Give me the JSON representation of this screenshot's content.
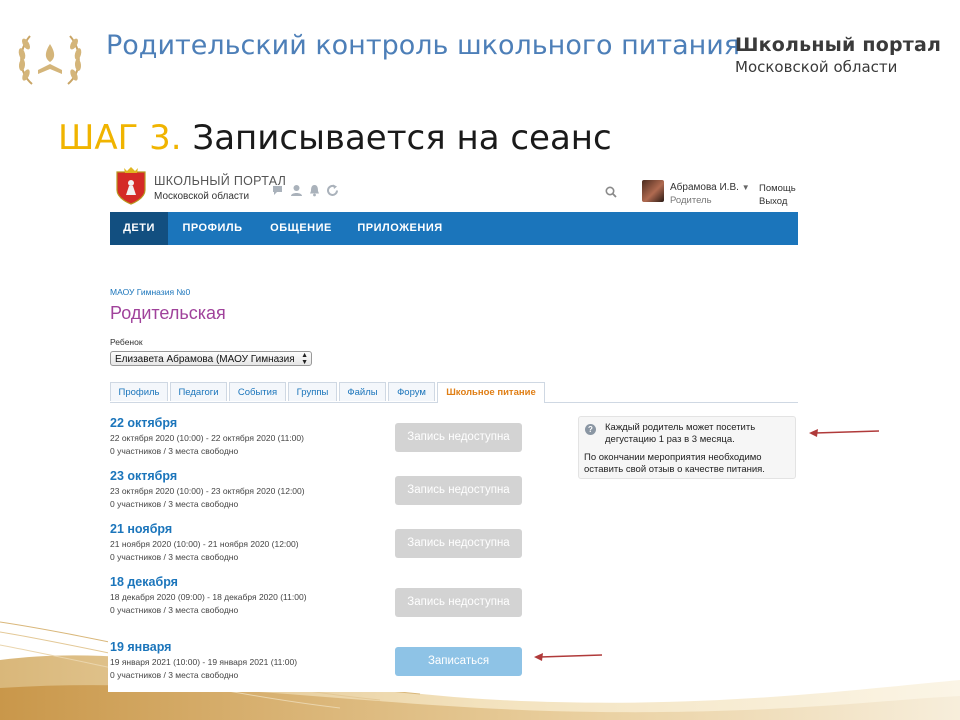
{
  "slide": {
    "title": "Родительский контроль школьного питания",
    "brand_line1": "Школьный портал",
    "brand_line2": "Московской области",
    "step_number": "ШАГ 3.",
    "step_text": "Записывается на сеанс"
  },
  "site": {
    "name": "ШКОЛЬНЫЙ ПОРТАЛ",
    "region": "Московской области",
    "header_icons": [
      "chat-icon",
      "user-icon",
      "bell-icon",
      "refresh-icon"
    ],
    "user_name": "Абрамова И.В.",
    "user_role": "Родитель",
    "help": "Помощь",
    "logout": "Выход"
  },
  "nav": {
    "items": [
      {
        "label": "ДЕТИ"
      },
      {
        "label": "ПРОФИЛЬ"
      },
      {
        "label": "ОБЩЕНИЕ"
      },
      {
        "label": "ПРИЛОЖЕНИЯ"
      }
    ]
  },
  "page": {
    "breadcrumb": "МАОУ Гимназия №0",
    "title": "Родительская",
    "child_label": "Ребенок",
    "child_value": "Елизавета Абрамова (МАОУ Гимназия"
  },
  "tabs": [
    {
      "label": "Профиль"
    },
    {
      "label": "Педагоги"
    },
    {
      "label": "События"
    },
    {
      "label": "Группы"
    },
    {
      "label": "Файлы"
    },
    {
      "label": "Форум"
    },
    {
      "label": "Школьное питание"
    }
  ],
  "sessions": [
    {
      "date": "22 октября",
      "time": "22 октября 2020 (10:00) - 22 октября 2020 (11:00)",
      "seats": "0 участников / 3 места свободно",
      "button": "Запись недоступна",
      "available": false
    },
    {
      "date": "23 октября",
      "time": "23 октября 2020 (10:00) - 23 октября 2020 (12:00)",
      "seats": "0 участников / 3 места свободно",
      "button": "Запись недоступна",
      "available": false
    },
    {
      "date": "21 ноября",
      "time": "21 ноября 2020 (10:00) - 21 ноября 2020 (12:00)",
      "seats": "0 участников / 3 места свободно",
      "button": "Запись недоступна",
      "available": false
    },
    {
      "date": "18 декабря",
      "time": "18 декабря 2020 (09:00) - 18 декабря 2020 (11:00)",
      "seats": "0 участников / 3 места свободно",
      "button": "Запись недоступна",
      "available": false
    },
    {
      "date": "19 января",
      "time": "19 января 2021 (10:00) - 19 января 2021 (11:00)",
      "seats": "0 участников / 3 места свободно",
      "button": "Записаться",
      "available": true
    }
  ],
  "info": {
    "icon": "question-icon",
    "text1": "Каждый родитель может посетить дегустацию 1 раз в 3 месяца.",
    "text2": "По окончании мероприятия необходимо оставить свой отзыв о качестве питания."
  },
  "colors": {
    "slide_title": "#4d7fb8",
    "step_accent": "#f0b400",
    "nav_bar": "#1b75bb",
    "nav_active": "#124f80",
    "page_title": "#a0429b",
    "active_tab": "#e07f16",
    "arrow": "#b03a3a",
    "button_disabled": "#d3d3d3",
    "button_enabled": "#8ec3e6"
  }
}
